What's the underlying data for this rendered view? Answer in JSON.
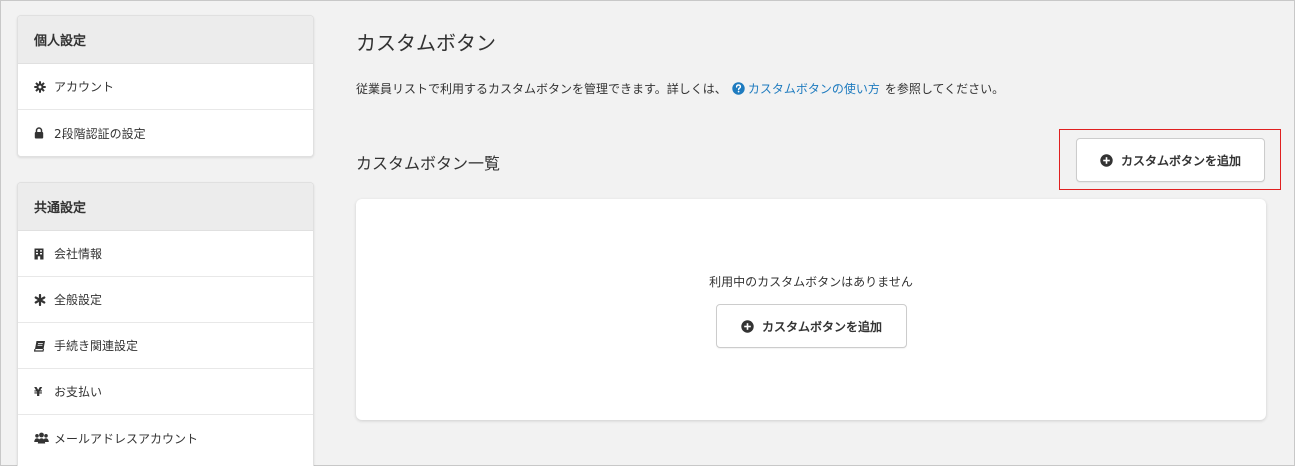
{
  "sidebar": {
    "personal": {
      "title": "個人設定",
      "items": [
        {
          "label": "アカウント",
          "icon": "gear-icon"
        },
        {
          "label": "2段階認証の設定",
          "icon": "lock-icon"
        }
      ]
    },
    "common": {
      "title": "共通設定",
      "items": [
        {
          "label": "会社情報",
          "icon": "building-icon"
        },
        {
          "label": "全般設定",
          "icon": "asterisk-icon"
        },
        {
          "label": "手続き関連設定",
          "icon": "book-icon"
        },
        {
          "label": "お支払い",
          "icon": "yen-icon",
          "glyph": "¥"
        },
        {
          "label": "メールアドレスアカウント",
          "icon": "users-icon"
        }
      ]
    }
  },
  "main": {
    "title": "カスタムボタン",
    "description_prefix": "従業員リストで利用するカスタムボタンを管理できます。詳しくは、",
    "help_link": "カスタムボタンの使い方",
    "description_suffix": "を参照してください。",
    "list_title": "カスタムボタン一覧",
    "add_button_label": "カスタムボタンを追加",
    "empty_message": "利用中のカスタムボタンはありません",
    "empty_add_button_label": "カスタムボタンを追加"
  },
  "colors": {
    "link": "#1e7bbf",
    "highlight": "#e02020",
    "icon_dark": "#333333"
  }
}
